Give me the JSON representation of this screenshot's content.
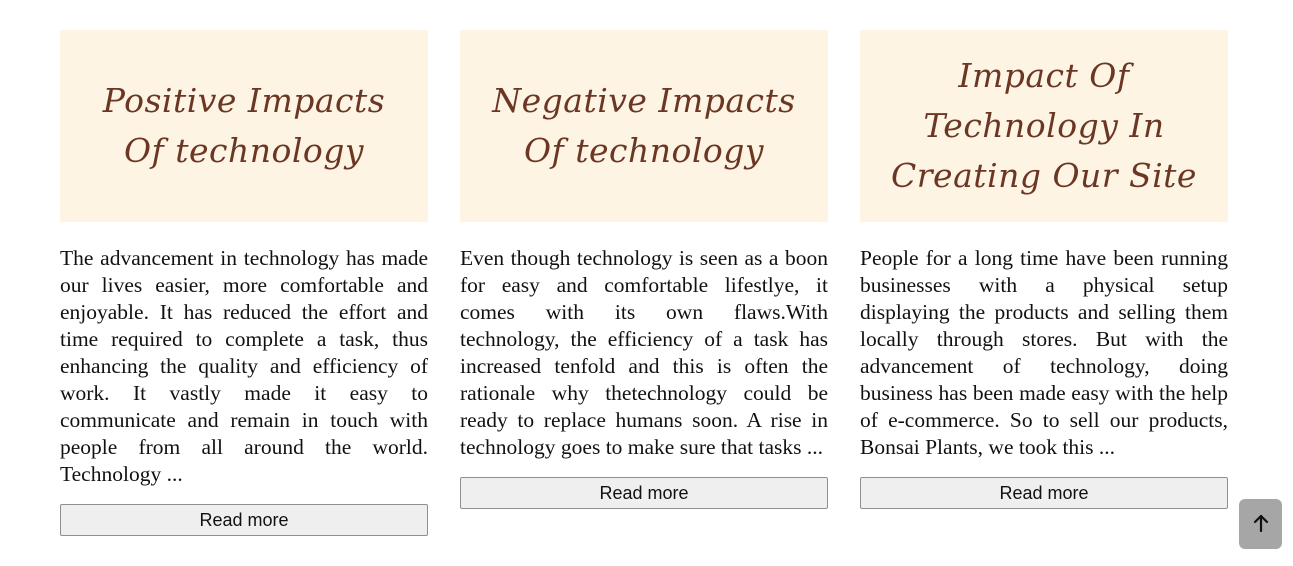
{
  "cards": [
    {
      "banner_title": "Positive Impacts Of technology",
      "excerpt": "The advancement in technology has made our lives easier, more comfortable and enjoyable. It has reduced the effort and time required to complete a task, thus enhancing the quality and efficiency of work. It vastly made it easy to communicate and remain in touch with people from all around the world. Technology ...",
      "button_label": "Read more"
    },
    {
      "banner_title": "Negative Impacts Of technology",
      "excerpt": "Even though technology is seen as a boon for easy and comfortable lifestlye, it comes with its own flaws.With technology, the efficiency of a task has increased tenfold and this is often the rationale why thetechnology could be ready to replace humans soon. A rise in technology goes to make sure that tasks ...",
      "button_label": "Read more"
    },
    {
      "banner_title": "Impact Of Technology In Creating Our Site",
      "excerpt": "People for a long time have been running businesses with a physical setup displaying the products and selling them locally through stores. But with the advancement of technology, doing business has been made easy with the help of e-commerce. So to sell our products, Bonsai Plants, we took this ...",
      "button_label": "Read more"
    }
  ],
  "back_to_top": {
    "icon": "arrow-up-icon"
  },
  "colors": {
    "banner_background": "#fdf4e3",
    "banner_text": "#6b3624",
    "button_background": "#efefef",
    "back_to_top_background": "#a6a6a6"
  }
}
